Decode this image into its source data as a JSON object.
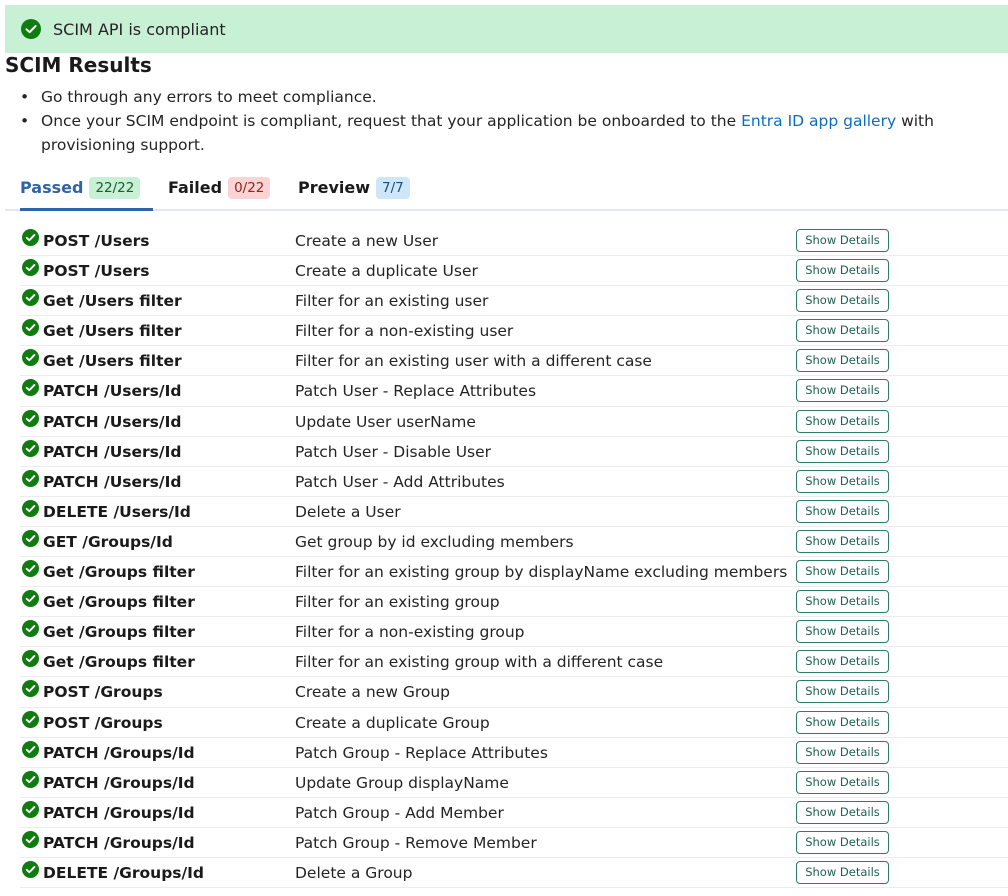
{
  "banner": {
    "text": "SCIM API is compliant",
    "icon": "check-circle-icon",
    "color": "#c8f0d4"
  },
  "title": "SCIM Results",
  "bullets": {
    "item1": "Go through any errors to meet compliance.",
    "item2_before": "Once your SCIM endpoint is compliant, request that your application be onboarded to the ",
    "item2_link": "Entra ID app gallery",
    "item2_after": " with provisioning support."
  },
  "tabs": [
    {
      "label": "Passed",
      "count": "22/22",
      "active": true
    },
    {
      "label": "Failed",
      "count": "0/22",
      "active": false
    },
    {
      "label": "Preview",
      "count": "7/7",
      "active": false
    }
  ],
  "button_label": "Show Details",
  "rows": [
    {
      "endpoint": "POST /Users",
      "description": "Create a new User",
      "status": "passed"
    },
    {
      "endpoint": "POST /Users",
      "description": "Create a duplicate User",
      "status": "passed"
    },
    {
      "endpoint": "Get /Users filter",
      "description": "Filter for an existing user",
      "status": "passed"
    },
    {
      "endpoint": "Get /Users filter",
      "description": "Filter for a non-existing user",
      "status": "passed"
    },
    {
      "endpoint": "Get /Users filter",
      "description": "Filter for an existing user with a different case",
      "status": "passed"
    },
    {
      "endpoint": "PATCH /Users/Id",
      "description": "Patch User - Replace Attributes",
      "status": "passed"
    },
    {
      "endpoint": "PATCH /Users/Id",
      "description": "Update User userName",
      "status": "passed"
    },
    {
      "endpoint": "PATCH /Users/Id",
      "description": "Patch User - Disable User",
      "status": "passed"
    },
    {
      "endpoint": "PATCH /Users/Id",
      "description": "Patch User - Add Attributes",
      "status": "passed"
    },
    {
      "endpoint": "DELETE /Users/Id",
      "description": "Delete a User",
      "status": "passed"
    },
    {
      "endpoint": "GET /Groups/Id",
      "description": "Get group by id excluding members",
      "status": "passed"
    },
    {
      "endpoint": "Get /Groups filter",
      "description": "Filter for an existing group by displayName excluding members",
      "status": "passed"
    },
    {
      "endpoint": "Get /Groups filter",
      "description": "Filter for an existing group",
      "status": "passed"
    },
    {
      "endpoint": "Get /Groups filter",
      "description": "Filter for a non-existing group",
      "status": "passed"
    },
    {
      "endpoint": "Get /Groups filter",
      "description": "Filter for an existing group with a different case",
      "status": "passed"
    },
    {
      "endpoint": "POST /Groups",
      "description": "Create a new Group",
      "status": "passed"
    },
    {
      "endpoint": "POST /Groups",
      "description": "Create a duplicate Group",
      "status": "passed"
    },
    {
      "endpoint": "PATCH /Groups/Id",
      "description": "Patch Group - Replace Attributes",
      "status": "passed"
    },
    {
      "endpoint": "PATCH /Groups/Id",
      "description": "Update Group displayName",
      "status": "passed"
    },
    {
      "endpoint": "PATCH /Groups/Id",
      "description": "Patch Group - Add Member",
      "status": "passed"
    },
    {
      "endpoint": "PATCH /Groups/Id",
      "description": "Patch Group - Remove Member",
      "status": "passed"
    },
    {
      "endpoint": "DELETE /Groups/Id",
      "description": "Delete a Group",
      "status": "passed"
    }
  ],
  "colors": {
    "success_green": "#107c10",
    "tab_active": "#2f65a6",
    "link": "#0f6cbd",
    "button_border": "#2d7a66"
  }
}
